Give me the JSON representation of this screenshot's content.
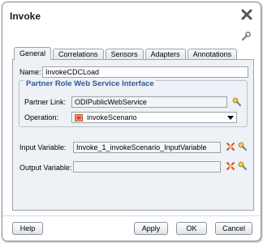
{
  "dialog": {
    "title": "Invoke"
  },
  "tabs": [
    {
      "label": "General",
      "active": true
    },
    {
      "label": "Correlations",
      "active": false
    },
    {
      "label": "Sensors",
      "active": false
    },
    {
      "label": "Adapters",
      "active": false
    },
    {
      "label": "Annotations",
      "active": false
    }
  ],
  "general": {
    "name_label": "Name:",
    "name_value": "InvokeCDCLoad",
    "group_title": "Partner Role Web Service Interface",
    "partner_link_label": "Partner Link:",
    "partner_link_value": "ODIPublicWebService",
    "operation_label": "Operation:",
    "operation_value": "invokeScenario",
    "input_variable_label": "Input Variable:",
    "input_variable_value": "Invoke_1_invokeScenario_InputVariable",
    "output_variable_label": "Output Variable:",
    "output_variable_value": ""
  },
  "buttons": {
    "help": "Help",
    "apply": "Apply",
    "ok": "OK",
    "cancel": "Cancel"
  },
  "colors": {
    "group_title": "#2d5a9a",
    "panel_bg": "#eef1f5",
    "close_icon": "#555555"
  }
}
